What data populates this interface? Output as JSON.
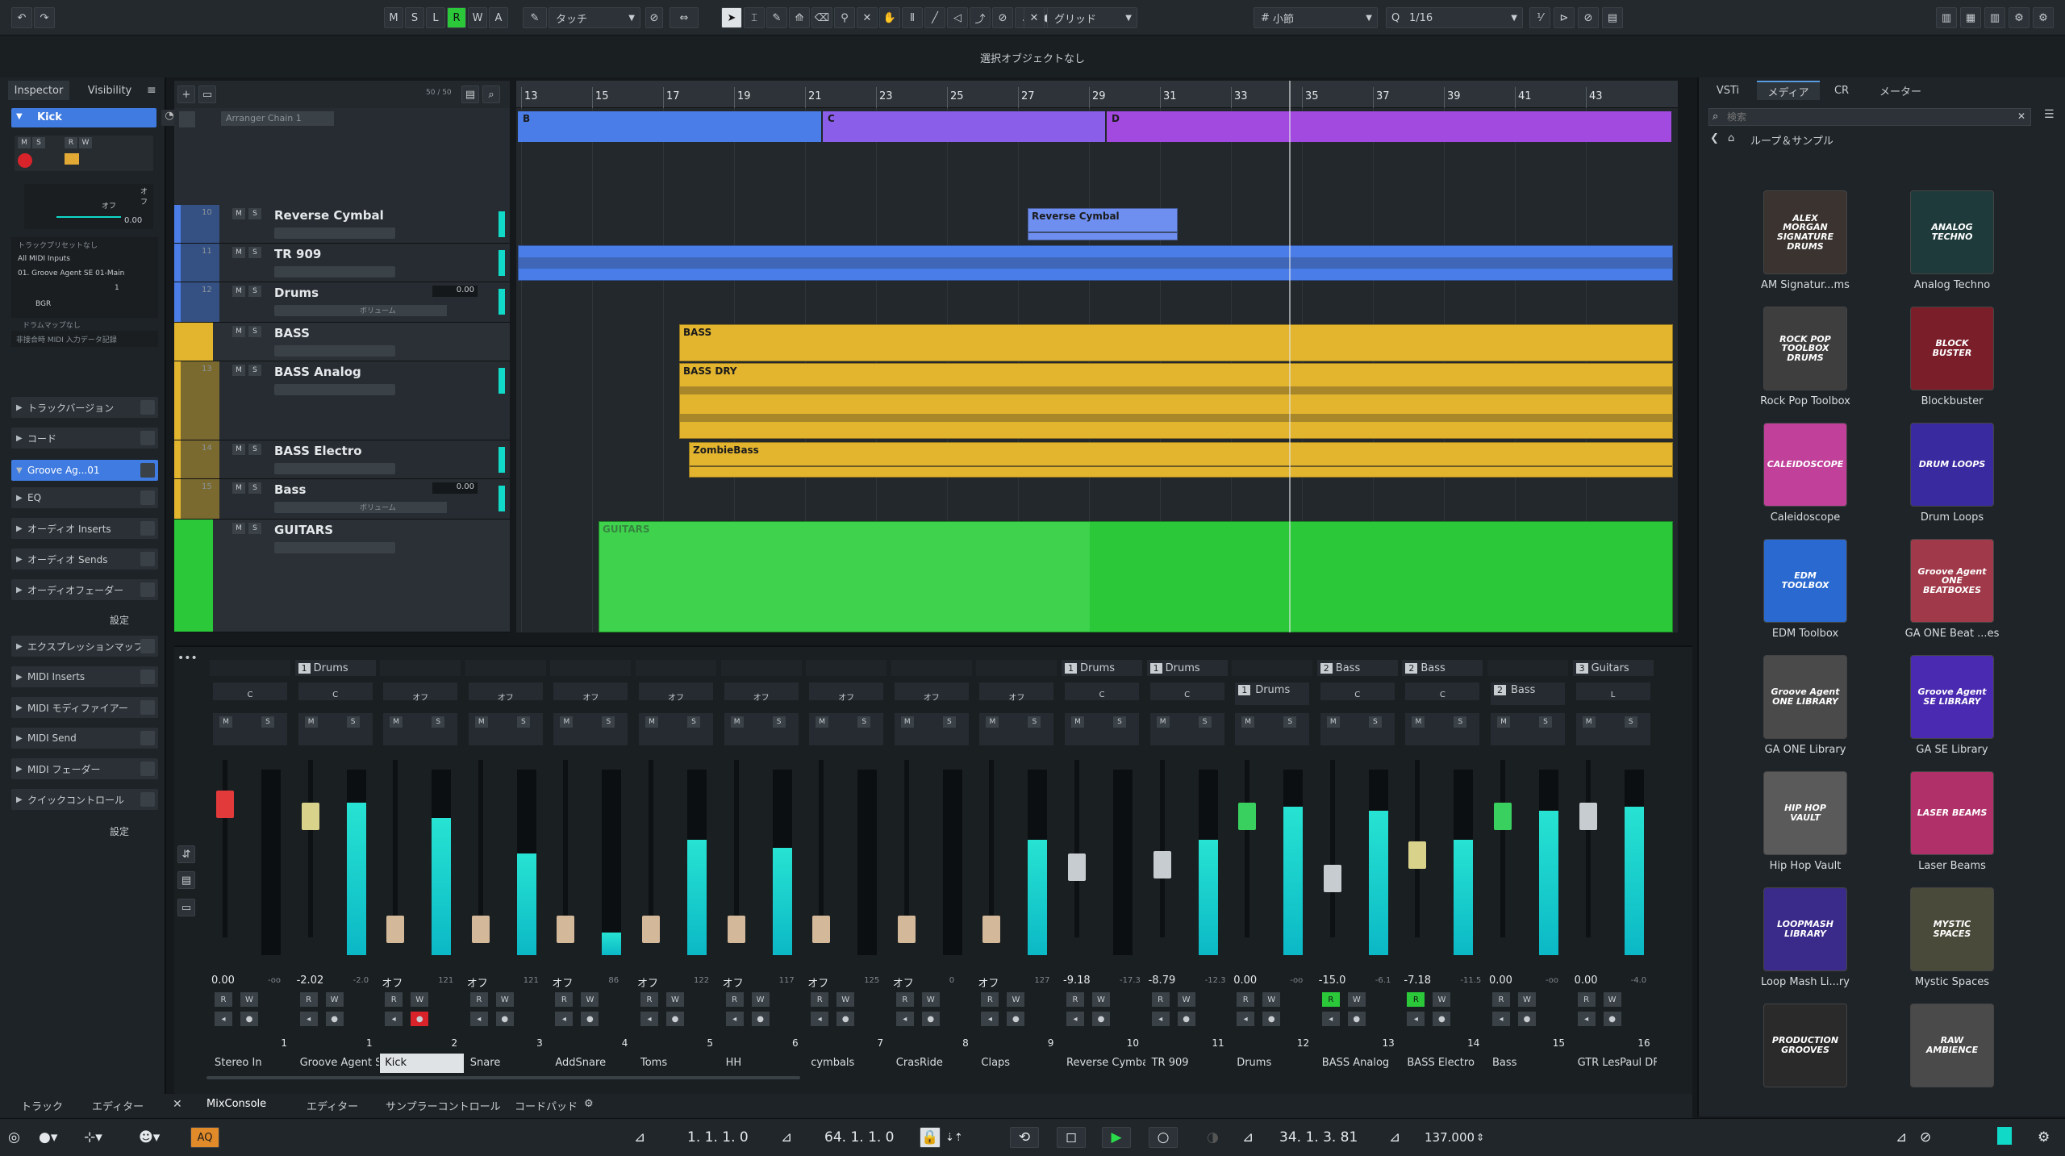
{
  "toolbar": {
    "undo_icon": "undo-icon",
    "redo_icon": "redo-icon",
    "state_buttons": [
      "M",
      "S",
      "L",
      "R",
      "W",
      "A"
    ],
    "automation_mode": "タッチ",
    "snap_type": "グリッド",
    "grid_type": "小節",
    "quantize": "1/16"
  },
  "status_line": "選択オブジェクトなし",
  "inspector": {
    "tabs": [
      "Inspector",
      "Visibility"
    ],
    "track_name": "Kick",
    "off_label_1": "オフ",
    "off_label_2": "オフ",
    "value": "0.00",
    "routing": {
      "preset": "トラックプリセットなし",
      "input": "All MIDI Inputs",
      "output": "01. Groove Agent SE 01-Main",
      "channel": "1",
      "bank": "BGR",
      "drum_map": "ドラムマップなし",
      "note": "非接合時 MIDI 入力データ記録"
    },
    "sections": [
      "トラックバージョン",
      "コード",
      "Groove Ag...01",
      "EQ",
      "オーディオ Inserts",
      "オーディオ Sends",
      "オーディオフェーダー",
      "エクスプレッションマップ",
      "MIDI Inserts",
      "MIDI モディファイアー",
      "MIDI Send",
      "MIDI フェーダー",
      "クイックコントロール"
    ],
    "settings": "設定"
  },
  "tracklist": {
    "counter": "50 / 50",
    "arranger": "Arranger Chain 1",
    "tracks": [
      {
        "num": "10",
        "name": "Reverse Cymbal",
        "color": "#4a7de8"
      },
      {
        "num": "11",
        "name": "TR 909",
        "color": "#4a7de8"
      },
      {
        "num": "12",
        "name": "Drums",
        "color": "#4a7de8",
        "vol": "0.00",
        "vlabel": "ボリューム"
      },
      {
        "num": "",
        "name": "BASS",
        "color": "#e3b52f"
      },
      {
        "num": "13",
        "name": "BASS Analog",
        "color": "#e3b52f"
      },
      {
        "num": "14",
        "name": "BASS Electro",
        "color": "#e3b52f"
      },
      {
        "num": "15",
        "name": "Bass",
        "color": "#e3b52f",
        "vol": "0.00",
        "vlabel": "ボリューム"
      },
      {
        "num": "",
        "name": "GUITARS",
        "color": "#2bc83a"
      }
    ]
  },
  "ruler": [
    "13",
    "15",
    "17",
    "19",
    "21",
    "23",
    "25",
    "27",
    "29",
    "31",
    "33",
    "35",
    "37",
    "39",
    "41",
    "43"
  ],
  "arranger_events": [
    {
      "label": "B",
      "color": "#4a7de8"
    },
    {
      "label": "C",
      "color": "#8a5ee8"
    },
    {
      "label": "D",
      "color": "#a24ae0"
    }
  ],
  "events": {
    "reverse_cymbal": "Reverse Cymbal",
    "bass": "BASS",
    "bass_dry": "BASS DRY",
    "zombie": "ZombieBass",
    "guitars": "GUITARS"
  },
  "media": {
    "tabs": [
      "VSTi",
      "メディア",
      "CR",
      "メーター"
    ],
    "search_placeholder": "検索",
    "breadcrumb": "ループ＆サンプル",
    "items": [
      {
        "label": "AM Signatur...ms",
        "art": "ALEX MORGAN SIGNATURE DRUMS",
        "bg": "#3a3330"
      },
      {
        "label": "Analog Techno",
        "art": "ANALOG TECHNO",
        "bg": "#1f3a3a"
      },
      {
        "label": "Rock Pop Toolbox",
        "art": "ROCK POP TOOLBOX DRUMS",
        "bg": "#3e3e3e"
      },
      {
        "label": "Blockbuster",
        "art": "BLOCK BUSTER",
        "bg": "#7a1e2a"
      },
      {
        "label": "Caleidoscope",
        "art": "CALEIDOSCOPE",
        "bg": "#c0409a"
      },
      {
        "label": "Drum Loops",
        "art": "DRUM LOOPS",
        "bg": "#3a2aa0"
      },
      {
        "label": "EDM Toolbox",
        "art": "EDM TOOLBOX",
        "bg": "#2a6ad0"
      },
      {
        "label": "GA ONE Beat ...es",
        "art": "Groove Agent ONE BEATBOXES",
        "bg": "#a03a4a"
      },
      {
        "label": "GA ONE Library",
        "art": "Groove Agent ONE LIBRARY",
        "bg": "#4a4a4a"
      },
      {
        "label": "GA SE Library",
        "art": "Groove Agent SE LIBRARY",
        "bg": "#4a2ab0"
      },
      {
        "label": "Hip Hop Vault",
        "art": "HIP HOP VAULT",
        "bg": "#5a5a5a"
      },
      {
        "label": "Laser Beams",
        "art": "LASER BEAMS",
        "bg": "#b0306a"
      },
      {
        "label": "Loop Mash Li...ry",
        "art": "LOOPMASH LIBRARY",
        "bg": "#3a2a8a"
      },
      {
        "label": "Mystic Spaces",
        "art": "MYSTIC SPACES",
        "bg": "#4a4a3a"
      },
      {
        "label": "",
        "art": "PRODUCTION GROOVES",
        "bg": "#2a2a2a"
      },
      {
        "label": "",
        "art": "RAW AMBIENCE",
        "bg": "#4a4a4a"
      }
    ]
  },
  "mixer": {
    "channels": [
      {
        "group": "",
        "name": "Stereo In",
        "num": "1",
        "vol": "0.00",
        "peak": "-oo",
        "fader": 0.82,
        "meter": 0.0,
        "cap": "#e23a3a",
        "pan": "C"
      },
      {
        "group": "1",
        "gname": "Drums",
        "name": "Groove Agent S",
        "num": "1",
        "vol": "-2.02",
        "peak": "-2.0",
        "fader": 0.75,
        "meter": 0.82,
        "cap": "#d8d28a",
        "pan": "C"
      },
      {
        "group": "",
        "name": "Kick",
        "num": "2",
        "vol": "オフ",
        "peak": "121",
        "fader": 0.08,
        "meter": 0.74,
        "cap": "#d3b89a",
        "pan": "オフ",
        "sel": true
      },
      {
        "group": "",
        "name": "Snare",
        "num": "3",
        "vol": "オフ",
        "peak": "121",
        "fader": 0.08,
        "meter": 0.55,
        "cap": "#d3b89a",
        "pan": "オフ"
      },
      {
        "group": "",
        "name": "AddSnare",
        "num": "4",
        "vol": "オフ",
        "peak": "86",
        "fader": 0.08,
        "meter": 0.12,
        "cap": "#d3b89a",
        "pan": "オフ"
      },
      {
        "group": "",
        "name": "Toms",
        "num": "5",
        "vol": "オフ",
        "peak": "122",
        "fader": 0.08,
        "meter": 0.62,
        "cap": "#d3b89a",
        "pan": "オフ"
      },
      {
        "group": "",
        "name": "HH",
        "num": "6",
        "vol": "オフ",
        "peak": "117",
        "fader": 0.08,
        "meter": 0.58,
        "cap": "#d3b89a",
        "pan": "オフ"
      },
      {
        "group": "",
        "name": "cymbals",
        "num": "7",
        "vol": "オフ",
        "peak": "125",
        "fader": 0.08,
        "meter": 0.0,
        "cap": "#d3b89a",
        "pan": "オフ"
      },
      {
        "group": "",
        "name": "CrasRide",
        "num": "8",
        "vol": "オフ",
        "peak": "0",
        "fader": 0.08,
        "meter": 0.0,
        "cap": "#d3b89a",
        "pan": "オフ"
      },
      {
        "group": "",
        "name": "Claps",
        "num": "9",
        "vol": "オフ",
        "peak": "127",
        "fader": 0.08,
        "meter": 0.62,
        "cap": "#d3b89a",
        "pan": "オフ"
      },
      {
        "group": "1",
        "gname": "Drums",
        "name": "Reverse Cymba",
        "num": "10",
        "vol": "-9.18",
        "peak": "-17.3",
        "fader": 0.45,
        "meter": 0.0,
        "cap": "#c6ccd0",
        "pan": "C"
      },
      {
        "group": "1",
        "gname": "Drums",
        "name": "TR 909",
        "num": "11",
        "vol": "-8.79",
        "peak": "-12.3",
        "fader": 0.46,
        "meter": 0.62,
        "cap": "#c6ccd0",
        "pan": "C"
      },
      {
        "group": "",
        "gname2": "Drums",
        "g2": "1",
        "name": "Drums",
        "num": "12",
        "vol": "0.00",
        "peak": "-oo",
        "fader": 0.75,
        "meter": 0.8,
        "cap": "#3ad060",
        "pan": ""
      },
      {
        "group": "2",
        "gname": "Bass",
        "name": "BASS Analog",
        "num": "13",
        "vol": "-15.0",
        "peak": "-6.1",
        "fader": 0.38,
        "meter": 0.78,
        "cap": "#c6ccd0",
        "pan": "C"
      },
      {
        "group": "2",
        "gname": "Bass",
        "name": "BASS Electro",
        "num": "14",
        "vol": "-7.18",
        "peak": "-11.5",
        "fader": 0.52,
        "meter": 0.62,
        "cap": "#d8d28a",
        "pan": "C"
      },
      {
        "group": "",
        "gname2": "Bass",
        "g2": "2",
        "name": "Bass",
        "num": "15",
        "vol": "0.00",
        "peak": "-oo",
        "fader": 0.75,
        "meter": 0.78,
        "cap": "#3ad060",
        "pan": ""
      },
      {
        "group": "3",
        "gname": "Guitars",
        "name": "GTR LesPaul DF",
        "num": "16",
        "vol": "0.00",
        "peak": "-4.0",
        "fader": 0.75,
        "meter": 0.8,
        "cap": "#c6ccd0",
        "pan": "L"
      }
    ]
  },
  "bottom_tabs": [
    "トラック",
    "エディター",
    "MixConsole",
    "エディター",
    "サンプラーコントロール",
    "コードパッド"
  ],
  "transport": {
    "left_locator": "1. 1. 1.  0",
    "right_locator": "64. 1. 1.  0",
    "position": "34. 1. 3. 81",
    "tempo": "137.000",
    "aq": "AQ"
  }
}
